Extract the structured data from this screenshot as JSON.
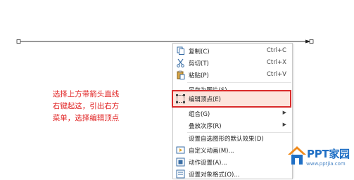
{
  "annotation": {
    "lines": [
      "选择上方带箭头直线",
      "右键起这，引出右方",
      "菜单，选择编辑顶点"
    ]
  },
  "context_menu": {
    "items": [
      {
        "label": "复制(C)",
        "shortcut": "Ctrl+C",
        "icon": "copy-icon"
      },
      {
        "label": "剪切(T)",
        "shortcut": "Ctrl+X",
        "icon": "scissors-icon"
      },
      {
        "label": "粘贴(P)",
        "shortcut": "Ctrl+V",
        "icon": "paste-icon"
      },
      {
        "label": "另存为图片(S)...",
        "shortcut": "",
        "icon": ""
      },
      {
        "label": "编辑顶点(E)",
        "shortcut": "",
        "icon": "edit-points-icon",
        "highlighted": true
      },
      {
        "label": "组合(G)",
        "shortcut": "",
        "icon": "",
        "submenu": true
      },
      {
        "label": "叠放次序(R)",
        "shortcut": "",
        "icon": "",
        "submenu": true
      },
      {
        "label": "设置自选图形的默认效果(D)",
        "shortcut": "",
        "icon": ""
      },
      {
        "label": "自定义动画(M)...",
        "shortcut": "",
        "icon": "animation-icon"
      },
      {
        "label": "动作设置(A)...",
        "shortcut": "",
        "icon": "action-icon"
      },
      {
        "label": "设置对象格式(O)...",
        "shortcut": "",
        "icon": "format-icon"
      }
    ]
  },
  "watermark": {
    "brand": "PPT家园",
    "url": "www.pptjia.com"
  },
  "colors": {
    "highlight_border": "#d92b2b",
    "highlight_fill": "#fde4dc",
    "annotation_text": "#e02020",
    "logo_blue": "#1f6fc5",
    "logo_orange": "#f08a1c"
  }
}
